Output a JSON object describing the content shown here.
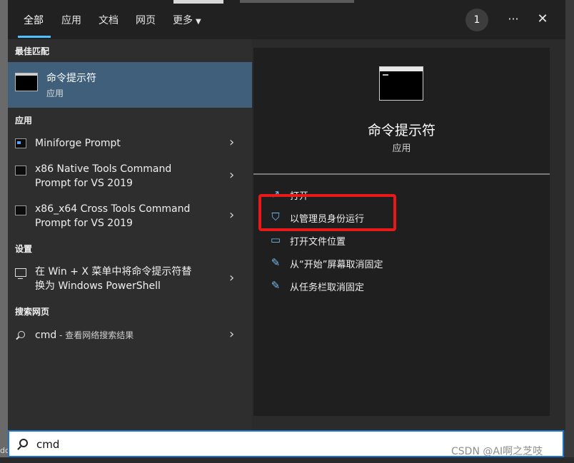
{
  "tabs": [
    {
      "label": "全部",
      "active": true
    },
    {
      "label": "应用"
    },
    {
      "label": "文档"
    },
    {
      "label": "网页"
    },
    {
      "label": "更多"
    }
  ],
  "badge_count": "1",
  "more_icon": "ellipsis-icon",
  "close_icon": "close-icon",
  "sections": {
    "best_match": "最佳匹配",
    "apps": "应用",
    "settings": "设置",
    "web": "搜索网页"
  },
  "best_match": {
    "name": "命令提示符",
    "type": "应用"
  },
  "apps": [
    {
      "line1": "Miniforge Prompt"
    },
    {
      "line1": "x86 Native Tools Command",
      "line2": "Prompt for VS 2019"
    },
    {
      "line1": "x86_x64 Cross Tools Command",
      "line2": "Prompt for VS 2019"
    }
  ],
  "settings_item": {
    "line1": "在 Win + X 菜单中将命令提示符替",
    "line2": "换为 Windows PowerShell"
  },
  "web_item": {
    "query": "cmd",
    "suffix": " - 查看网络搜索结果"
  },
  "preview": {
    "name": "命令提示符",
    "type": "应用"
  },
  "actions": [
    {
      "label": "打开",
      "icon": "open-icon"
    },
    {
      "label": "以管理员身份运行",
      "icon": "shield-icon"
    },
    {
      "label": "打开文件位置",
      "icon": "folder-icon"
    },
    {
      "label": "从“开始”屏幕取消固定",
      "icon": "unpin-icon"
    },
    {
      "label": "从任务栏取消固定",
      "icon": "unpin-icon"
    }
  ],
  "search": {
    "value": "cmd"
  },
  "watermark": "CSDN @AI啊之芝吱",
  "colors": {
    "accent": "#4cc2ff",
    "selected": "#3f5f7a",
    "highlight_box": "#e8191b"
  }
}
